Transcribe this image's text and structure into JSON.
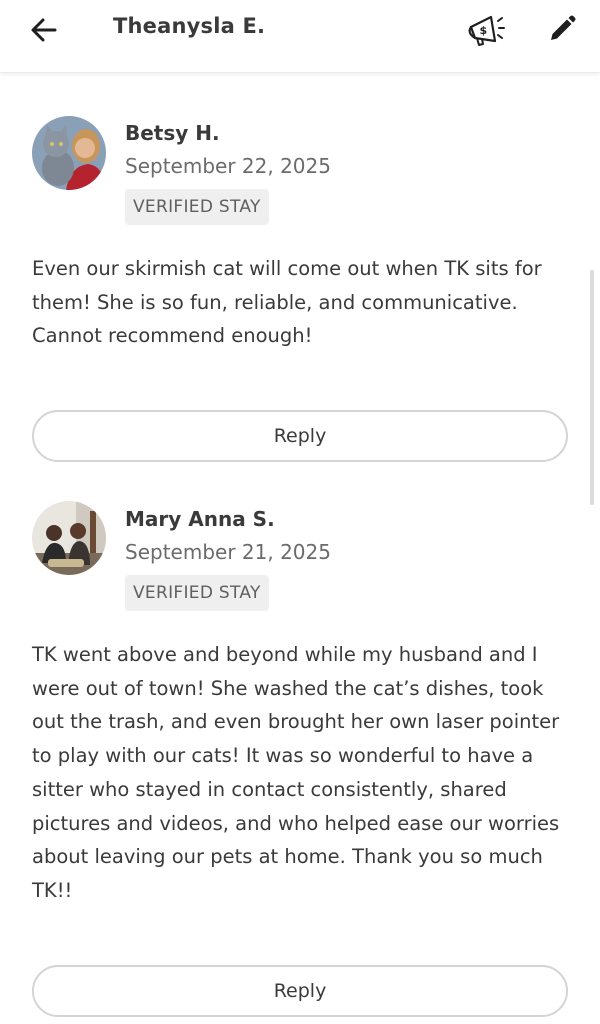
{
  "header": {
    "title": "Theanysla E.",
    "back_icon": "arrow-left-icon",
    "promo_icon": "megaphone-dollar-icon",
    "edit_icon": "pencil-icon"
  },
  "reviews": [
    {
      "name": "Betsy H.",
      "date": "September 22, 2025",
      "badge": "VERIFIED STAY",
      "text": "Even our skirmish cat will come out when TK sits for them! She is so fun, reliable, and communicative. Cannot recommend enough!",
      "reply_label": "Reply"
    },
    {
      "name": "Mary Anna S.",
      "date": "September 21, 2025",
      "badge": "VERIFIED STAY",
      "text": "TK went above and beyond while my husband and I were out of town! She washed the cat’s dishes, took out the trash, and even brought her own laser pointer to play with our cats! It was so wonderful to have a sitter who stayed in contact consistently, shared pictures and videos, and who helped ease our worries about leaving our pets at home. Thank you so much TK!!",
      "reply_label": "Reply"
    }
  ],
  "colors": {
    "text": "#3a3a3a",
    "muted": "#6b6b6b",
    "badge_bg": "#efefef",
    "border": "#d4d4d4"
  }
}
